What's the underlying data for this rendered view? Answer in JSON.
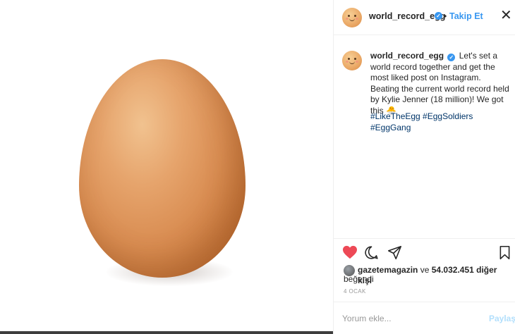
{
  "post": {
    "image_alt": "egg"
  },
  "header": {
    "username": "world_record_egg",
    "separator": "•",
    "follow_label": "Takip Et",
    "close_symbol": "✕"
  },
  "caption": {
    "username": "world_record_egg",
    "text": "Let's set a world record together and get the most liked post on Instagram. Beating the current world record held by Kylie Jenner (18 million)! We got this 🐣",
    "hashtags": "#LikeTheEgg #EggSoldiers #EggGang"
  },
  "actions": {
    "like_icon": "heart-icon",
    "comment_icon": "comment-icon",
    "share_icon": "share-icon",
    "save_icon": "bookmark-icon",
    "liked": true
  },
  "likes": {
    "user": "gazetemagazin",
    "connector": "ve",
    "count_text": "54.032.451 diğer kişi",
    "suffix": "beğendi"
  },
  "date": "4 OCAK",
  "comment": {
    "placeholder": "Yorum ekle...",
    "submit_label": "Paylaş"
  },
  "colors": {
    "accent": "#3897f0",
    "like_red": "#ed4956",
    "hashtag": "#003569",
    "muted": "#999999",
    "share_disabled": "#b2dffc"
  }
}
